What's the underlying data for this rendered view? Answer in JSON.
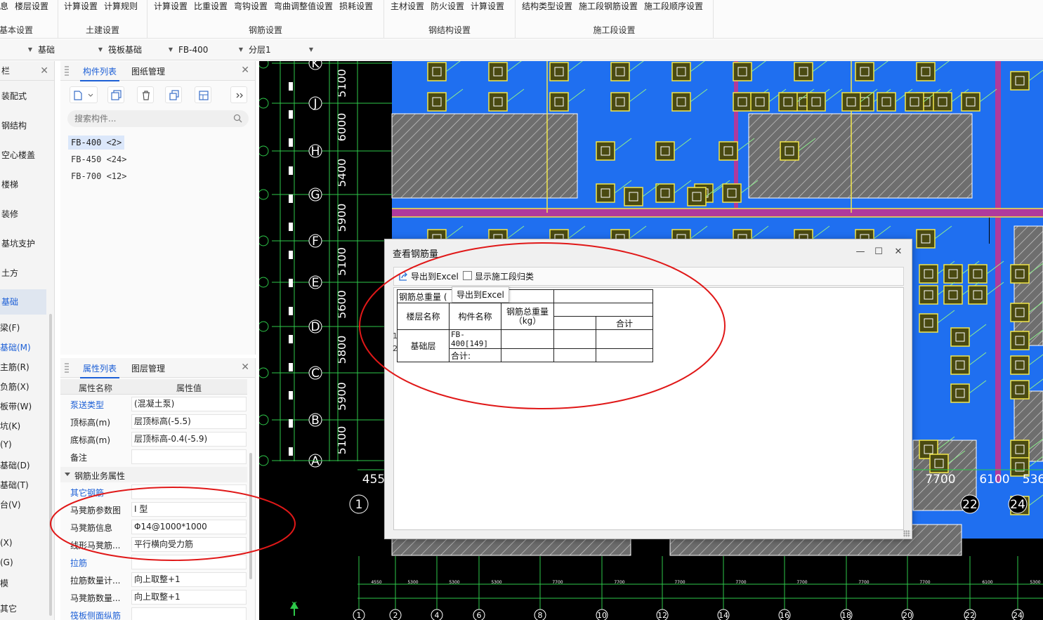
{
  "ribbon": {
    "groups": [
      {
        "title": "基本设置",
        "items": [
          "息",
          "楼层设置"
        ]
      },
      {
        "title": "土建设置",
        "items": [
          "计算设置",
          "计算规则"
        ]
      },
      {
        "title": "钢筋设置",
        "items": [
          "计算设置",
          "比重设置",
          "弯钩设置",
          "弯曲调整值设置",
          "损耗设置"
        ]
      },
      {
        "title": "钢结构设置",
        "items": [
          "主材设置",
          "防火设置",
          "计算设置"
        ]
      },
      {
        "title": "施工段设置",
        "items": [
          "结构类型设置",
          "施工段钢筋设置",
          "施工段顺序设置"
        ]
      }
    ]
  },
  "selectors": {
    "floor": "",
    "type": "基础",
    "subtype": "筏板基础",
    "component": "FB-400",
    "layer": "分层1"
  },
  "leftnav": {
    "header": "栏",
    "items": [
      "装配式",
      "钢结构",
      "空心楼盖",
      "楼梯",
      "装修",
      "基坑支护",
      "土方",
      "基础"
    ],
    "subitems": [
      "梁(F)",
      "基础(M)",
      "主筋(R)",
      "负筋(X)",
      "板带(W)",
      "坑(K)",
      "(Y)",
      "基础(D)",
      "基础(T)",
      "台(V)",
      "",
      "(X)",
      "(G)",
      "模",
      "其它"
    ]
  },
  "component_panel": {
    "tabs": [
      "构件列表",
      "图纸管理"
    ],
    "search_placeholder": "搜索构件...",
    "components": [
      "FB-400 <2>",
      "FB-450 <24>",
      "FB-700 <12>"
    ]
  },
  "property_panel": {
    "tabs": [
      "属性列表",
      "图层管理"
    ],
    "col_name": "属性名称",
    "col_value": "属性值",
    "rows1": [
      {
        "name": "泵送类型",
        "value": "(混凝土泵)"
      },
      {
        "name": "顶标高(m)",
        "value": "层顶标高(-5.5)"
      },
      {
        "name": "底标高(m)",
        "value": "层顶标高-0.4(-5.9)"
      },
      {
        "name": "备注",
        "value": ""
      }
    ],
    "section": "钢筋业务属性",
    "rows2": [
      {
        "name": "其它钢筋",
        "value": ""
      },
      {
        "name": "马凳筋参数图",
        "value": "I 型"
      },
      {
        "name": "马凳筋信息",
        "value": "Φ14@1000*1000"
      },
      {
        "name": "线形马凳筋...",
        "value": "平行横向受力筋"
      },
      {
        "name": "拉筋",
        "value": ""
      },
      {
        "name": "拉筋数量计...",
        "value": "向上取整+1"
      },
      {
        "name": "马凳筋数量...",
        "value": "向上取整+1"
      },
      {
        "name": "筏板侧面纵筋",
        "value": ""
      }
    ]
  },
  "drawing": {
    "axis_rows": [
      "K",
      "J",
      "H",
      "G",
      "F",
      "E",
      "D",
      "C",
      "B",
      "A"
    ],
    "row_dims": [
      "5100",
      "6000",
      "5400",
      "5900",
      "5100",
      "5600",
      "5800",
      "5900",
      "5100"
    ],
    "axis_cols": [
      "1",
      "2",
      "4",
      "6",
      "8",
      "10",
      "12",
      "14",
      "16",
      "18",
      "20",
      "22",
      "24"
    ],
    "top_dims": [
      "455",
      "7700",
      "6100",
      "536"
    ],
    "big_labels": [
      "1",
      "22",
      "24"
    ],
    "small_dims": [
      "4550",
      "5300",
      "5300",
      "5300",
      "7700",
      "7700",
      "7700",
      "7700",
      "7700",
      "7700",
      "7700",
      "6100",
      "5300"
    ],
    "ucs": "Y"
  },
  "dialog": {
    "title": "查看钢筋量",
    "export_label": "导出到Excel",
    "checkbox_label": "显示施工段归类",
    "checkbox_checked": false,
    "tooltip": "导出到Excel",
    "table": {
      "caption": "钢筋总重量 (",
      "headers": [
        "楼层名称",
        "构件名称",
        "钢筋总重量\n（kg）"
      ],
      "total_header": "合计",
      "floor": "基础层",
      "component": "FB-400[149]",
      "sum_label": "合计:",
      "row_numbers": [
        "1",
        "2"
      ]
    }
  }
}
